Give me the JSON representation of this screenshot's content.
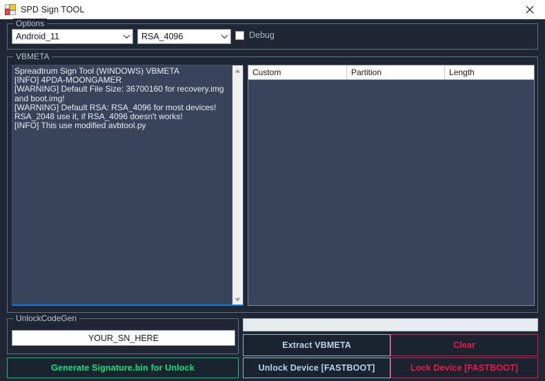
{
  "window": {
    "title": "SPD Sign TOOL",
    "icon": "app-window-icon",
    "close_label": "✕"
  },
  "options": {
    "legend": "Options",
    "android_version": {
      "value": "Android_11",
      "arrow_icon": "chevron-down-icon"
    },
    "rsa_key": {
      "value": "RSA_4096",
      "arrow_icon": "chevron-down-icon"
    },
    "debug": {
      "label": "Debug",
      "checked": false
    }
  },
  "vbmeta": {
    "legend": "VBMETA",
    "log": "Spreadtrum Sign Tool (WINDOWS) VBMETA\n[INFO] 4PDA-MOONGAMER\n[WARNING] Default File Size: 36700160 for recovery.img and boot.img!\n[WARNING] Default RSA: RSA_4096 for most devices!\nRSA_2048 use it, if RSA_4096 doesn't works!\n[INFO] This use modified avbtool.py",
    "scrollbar": {
      "up_icon": "scroll-up-arrow-icon",
      "down_icon": "scroll-down-arrow-icon"
    },
    "table": {
      "columns": [
        "Custom",
        "Partition",
        "Length"
      ],
      "rows": []
    }
  },
  "unlock_code_gen": {
    "legend": "UnlockCodeGen",
    "serial_value": "YOUR_SN_HERE",
    "generate_label": "Generate Signature.bin for Unlock"
  },
  "actions": {
    "extract_label": "Extract VBMETA",
    "clear_label": "Clear",
    "unlock_label": "Unlock Device [FASTBOOT]",
    "lock_label": "Lock Device [FASTBOOT]"
  },
  "progress": {
    "value": 0
  },
  "colors": {
    "window_background": "#1e2733",
    "field_background": "#39445c",
    "group_border": "#5f7183",
    "accent_blue": "#bcd3e8",
    "accent_red": "#f5184a",
    "accent_green": "#0be77b",
    "focus_underline": "#1477d1"
  }
}
